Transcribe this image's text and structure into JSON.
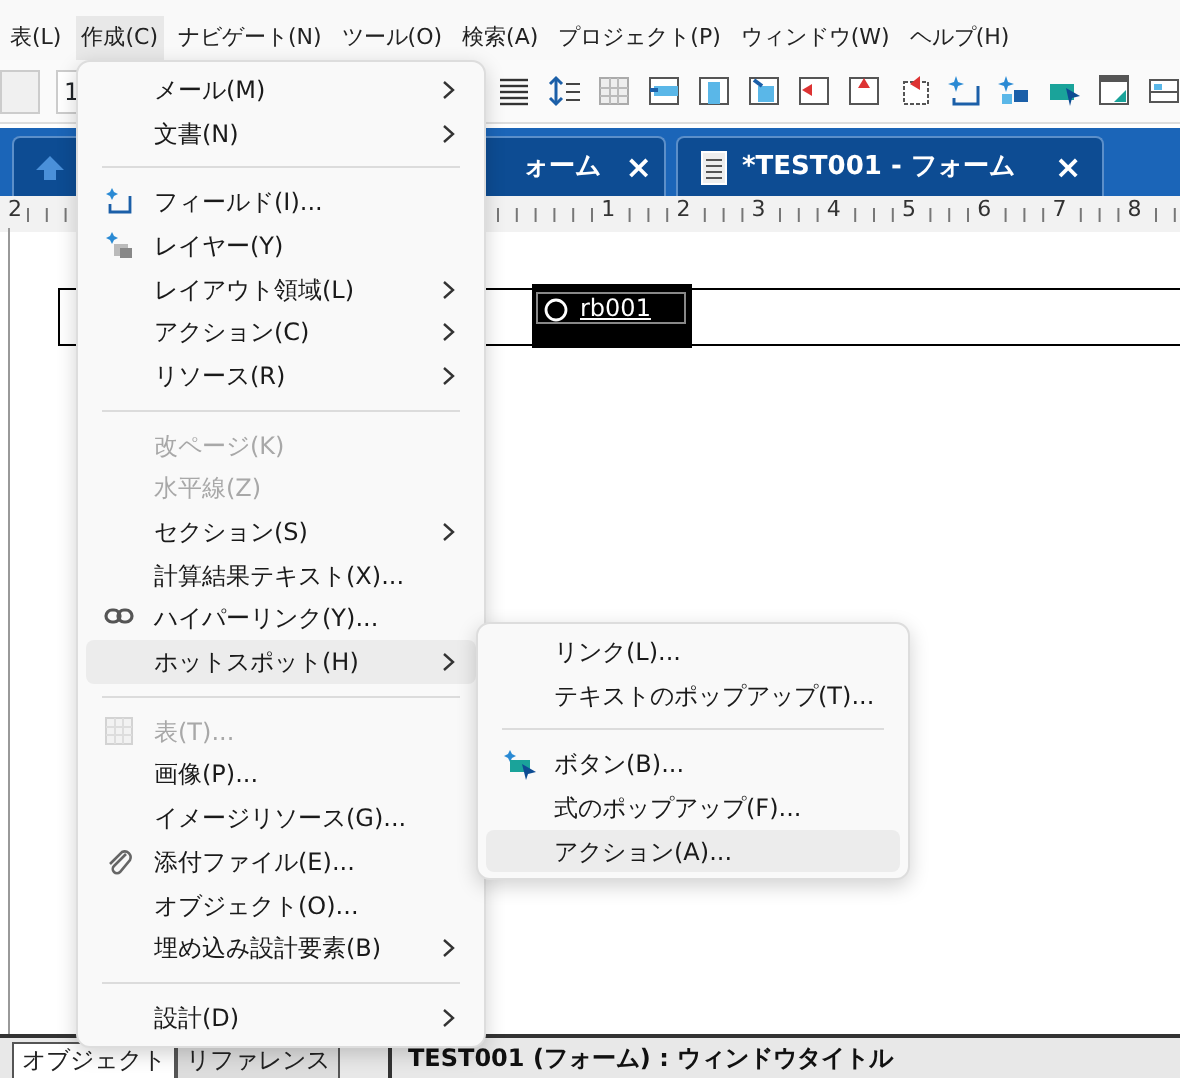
{
  "menubar": [
    {
      "label": "表(L)",
      "selected": false
    },
    {
      "label": "作成(C)",
      "selected": true
    },
    {
      "label": "ナビゲート(N)",
      "selected": false
    },
    {
      "label": "ツール(O)",
      "selected": false
    },
    {
      "label": "検索(A)",
      "selected": false
    },
    {
      "label": "プロジェクト(P)",
      "selected": false
    },
    {
      "label": "ウィンドウ(W)",
      "selected": false
    },
    {
      "label": "ヘルプ(H)",
      "selected": false
    }
  ],
  "toolbar": {
    "font_size": "1"
  },
  "tabs": [
    {
      "label": "ォーム",
      "close": "×"
    },
    {
      "label": "*TEST001 - フォーム",
      "close": "×"
    }
  ],
  "ruler": {
    "labels": [
      "2",
      "1",
      "2",
      "3",
      "4",
      "5",
      "6",
      "7",
      "8"
    ]
  },
  "document": {
    "field_text": "rb001"
  },
  "create_menu": [
    {
      "kind": "item",
      "label": "メール(M)",
      "submenu": true,
      "disabled": false,
      "selected": false
    },
    {
      "kind": "item",
      "label": "文書(N)",
      "submenu": true,
      "disabled": false,
      "selected": false
    },
    {
      "kind": "separator"
    },
    {
      "kind": "item",
      "label": "フィールド(I)...",
      "submenu": false,
      "disabled": false,
      "selected": false
    },
    {
      "kind": "item",
      "label": "レイヤー(Y)",
      "submenu": false,
      "disabled": false,
      "selected": false
    },
    {
      "kind": "item",
      "label": "レイアウト領域(L)",
      "submenu": true,
      "disabled": false,
      "selected": false
    },
    {
      "kind": "item",
      "label": "アクション(C)",
      "submenu": true,
      "disabled": false,
      "selected": false
    },
    {
      "kind": "item",
      "label": "リソース(R)",
      "submenu": true,
      "disabled": false,
      "selected": false
    },
    {
      "kind": "separator"
    },
    {
      "kind": "item",
      "label": "改ページ(K)",
      "submenu": false,
      "disabled": true,
      "selected": false
    },
    {
      "kind": "item",
      "label": "水平線(Z)",
      "submenu": false,
      "disabled": true,
      "selected": false
    },
    {
      "kind": "item",
      "label": "セクション(S)",
      "submenu": true,
      "disabled": false,
      "selected": false
    },
    {
      "kind": "item",
      "label": "計算結果テキスト(X)...",
      "submenu": false,
      "disabled": false,
      "selected": false
    },
    {
      "kind": "item",
      "label": "ハイパーリンク(Y)...",
      "submenu": false,
      "disabled": false,
      "selected": false
    },
    {
      "kind": "item",
      "label": "ホットスポット(H)",
      "submenu": true,
      "disabled": false,
      "selected": true
    },
    {
      "kind": "separator"
    },
    {
      "kind": "item",
      "label": "表(T)...",
      "submenu": false,
      "disabled": true,
      "selected": false
    },
    {
      "kind": "item",
      "label": "画像(P)...",
      "submenu": false,
      "disabled": false,
      "selected": false
    },
    {
      "kind": "item",
      "label": "イメージリソース(G)...",
      "submenu": false,
      "disabled": false,
      "selected": false
    },
    {
      "kind": "item",
      "label": "添付ファイル(E)...",
      "submenu": false,
      "disabled": false,
      "selected": false
    },
    {
      "kind": "item",
      "label": "オブジェクト(O)...",
      "submenu": false,
      "disabled": false,
      "selected": false
    },
    {
      "kind": "item",
      "label": "埋め込み設計要素(B)",
      "submenu": true,
      "disabled": false,
      "selected": false
    },
    {
      "kind": "separator"
    },
    {
      "kind": "item",
      "label": "設計(D)",
      "submenu": true,
      "disabled": false,
      "selected": false
    }
  ],
  "hotspot_submenu": [
    {
      "kind": "item",
      "label": "リンク(L)...",
      "selected": false
    },
    {
      "kind": "item",
      "label": "テキストのポップアップ(T)...",
      "selected": false
    },
    {
      "kind": "separator"
    },
    {
      "kind": "item",
      "label": "ボタン(B)...",
      "selected": false
    },
    {
      "kind": "item",
      "label": "式のポップアップ(F)...",
      "selected": false
    },
    {
      "kind": "item",
      "label": "アクション(A)...",
      "selected": true
    }
  ],
  "bottom_tabs": [
    {
      "label": "オブジェクト",
      "selected": true
    },
    {
      "label": "リファレンス",
      "selected": false
    }
  ],
  "status_bar": "TEST001 (フォーム) : ウィンドウタイトル"
}
